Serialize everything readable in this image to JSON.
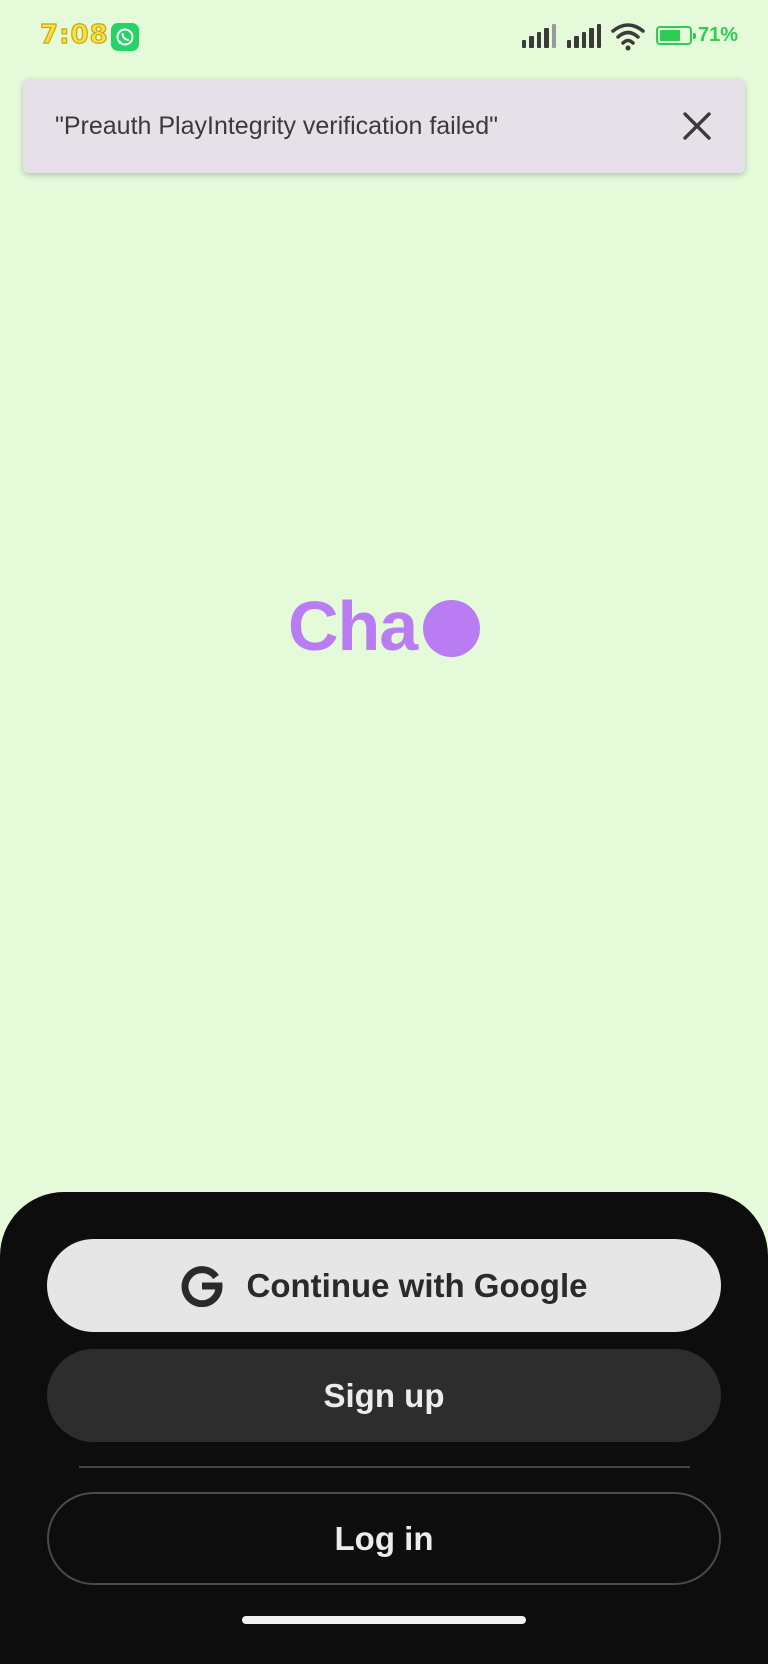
{
  "status_bar": {
    "time": "7:08",
    "battery_percent_label": "71%",
    "battery_level": 0.71,
    "icons": [
      "whatsapp-icon",
      "signal-icon",
      "signal-icon",
      "wifi-icon",
      "battery-icon"
    ]
  },
  "toast": {
    "message": "\"Preauth PlayIntegrity verification failed\"",
    "close_icon": "close-icon"
  },
  "logo": {
    "text": "Cha"
  },
  "auth": {
    "google_label": "Continue with Google",
    "signup_label": "Sign up",
    "login_label": "Log in"
  },
  "colors": {
    "background": "#e4fad8",
    "brand": "#b97cf3",
    "sheet": "#0d0d0d",
    "google_button": "#e6e6e6",
    "signup_button": "#2d2d2d"
  }
}
